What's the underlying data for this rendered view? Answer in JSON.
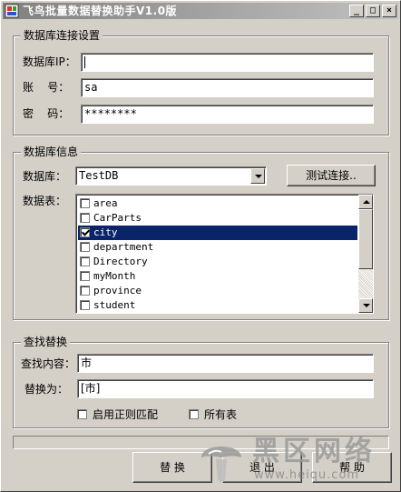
{
  "window": {
    "title": "飞鸟批量数据替换助手V1.0版",
    "min_label": "_",
    "max_label": "□",
    "close_label": "×"
  },
  "connection": {
    "legend": "数据库连接设置",
    "ip_label": "数据库IP：",
    "ip_value": "",
    "account_label": "账    号：",
    "account_value": "sa",
    "password_label": "密    码：",
    "password_value": "********"
  },
  "dbinfo": {
    "legend": "数据库信息",
    "database_label": "数据库：",
    "database_selected": "TestDB",
    "test_button": "测试连接..",
    "tables_label": "数据表：",
    "tables": [
      {
        "name": "area",
        "checked": false,
        "selected": false
      },
      {
        "name": "CarParts",
        "checked": false,
        "selected": false
      },
      {
        "name": "city",
        "checked": true,
        "selected": true
      },
      {
        "name": "department",
        "checked": false,
        "selected": false
      },
      {
        "name": "Directory",
        "checked": false,
        "selected": false
      },
      {
        "name": "myMonth",
        "checked": false,
        "selected": false
      },
      {
        "name": "province",
        "checked": false,
        "selected": false
      },
      {
        "name": "student",
        "checked": false,
        "selected": false
      }
    ]
  },
  "replace": {
    "legend": "查找替换",
    "find_label": "查找内容：",
    "find_value": "市",
    "replace_label": "替换为：",
    "replace_value": "[市]",
    "regex_label": "启用正则匹配",
    "regex_checked": false,
    "all_tables_label": "所有表",
    "all_tables_checked": false
  },
  "progress": {
    "value": 0
  },
  "actions": {
    "replace_button": "替 换",
    "exit_button": "退 出",
    "help_button": "帮 助"
  },
  "watermark": {
    "brand": "黑区网络",
    "url": "www.heiqu.com"
  },
  "colors": {
    "face": "#d4d0c8",
    "selection": "#0a246a",
    "title_gradient_start": "#808080"
  }
}
